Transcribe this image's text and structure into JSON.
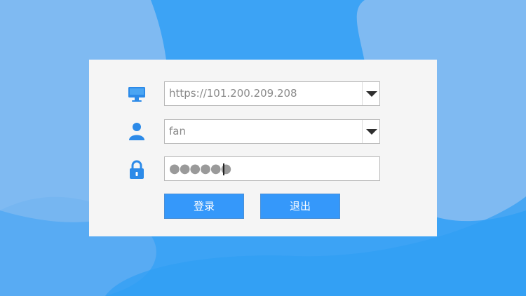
{
  "background": {
    "primary": "#3ca3f5",
    "secondary": "#7fbaf2",
    "panel": "#f5f5f5",
    "button": "#3598fa"
  },
  "form": {
    "server": {
      "icon": "monitor-icon",
      "value": "https://101.200.209.208"
    },
    "user": {
      "icon": "user-icon",
      "value": "fan"
    },
    "password": {
      "icon": "lock-icon",
      "masked": "●●●●●●"
    }
  },
  "buttons": {
    "login": "登录",
    "exit": "退出"
  }
}
